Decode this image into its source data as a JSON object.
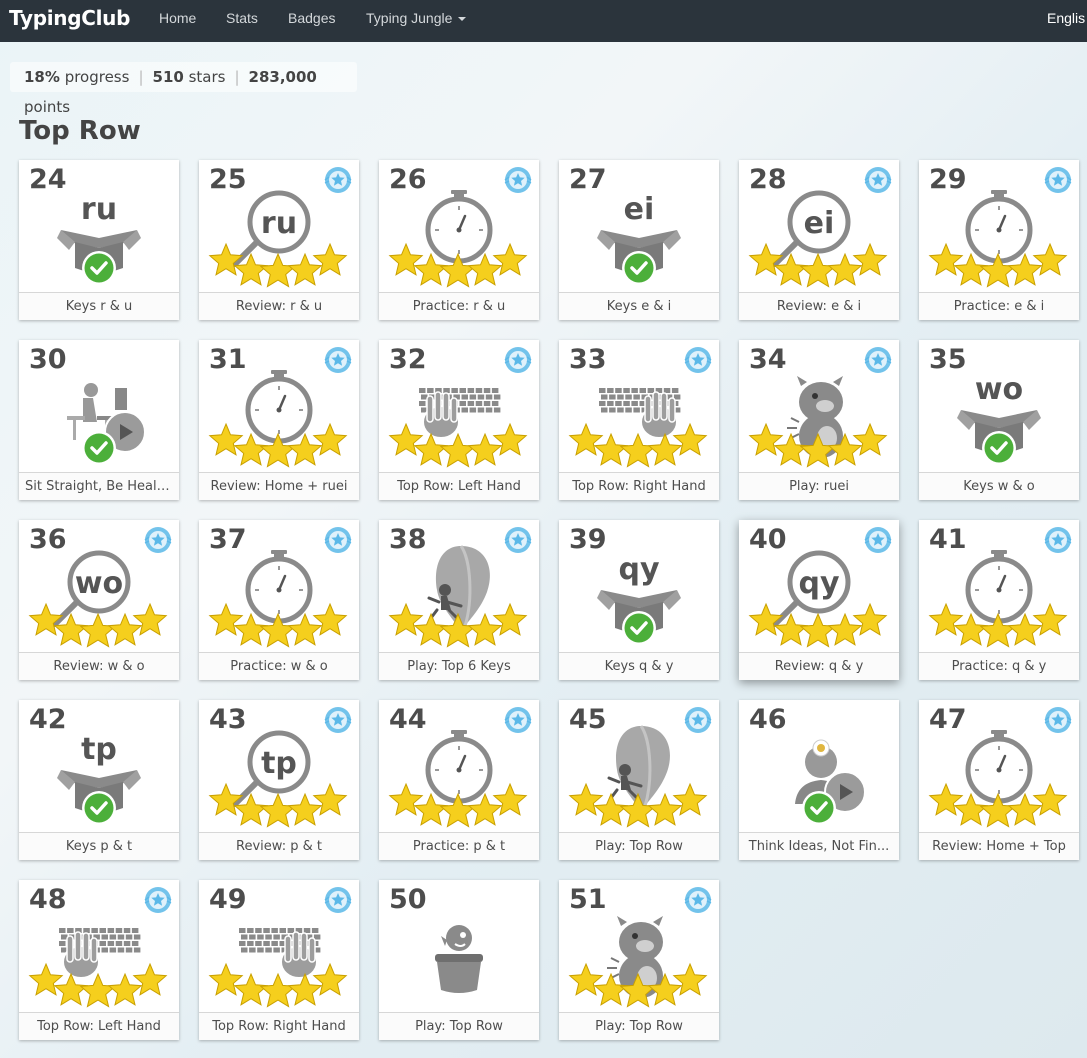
{
  "nav": {
    "brand": "TypingClub",
    "items": [
      "Home",
      "Stats",
      "Badges",
      "Typing Jungle"
    ],
    "language": "Englis"
  },
  "progress": {
    "percent": "18%",
    "percent_label": "progress",
    "stars": "510",
    "stars_label": "stars",
    "points": "283,000",
    "points_label": "points"
  },
  "section": {
    "title": "Top Row"
  },
  "lessons": [
    {
      "num": "24",
      "title": "Keys r & u",
      "kind": "box",
      "keys": "ru",
      "badge": false,
      "stars": 0
    },
    {
      "num": "25",
      "title": "Review: r & u",
      "kind": "review",
      "keys": "ru",
      "badge": true,
      "stars": 5
    },
    {
      "num": "26",
      "title": "Practice: r & u",
      "kind": "timer",
      "badge": true,
      "stars": 5
    },
    {
      "num": "27",
      "title": "Keys e & i",
      "kind": "box",
      "keys": "ei",
      "badge": false,
      "stars": 0
    },
    {
      "num": "28",
      "title": "Review: e & i",
      "kind": "review",
      "keys": "ei",
      "badge": true,
      "stars": 5
    },
    {
      "num": "29",
      "title": "Practice: e & i",
      "kind": "timer",
      "badge": true,
      "stars": 5
    },
    {
      "num": "30",
      "title": "Sit Straight, Be Healt...",
      "kind": "video-desk",
      "badge": false,
      "stars": 0
    },
    {
      "num": "31",
      "title": "Review: Home + ruei",
      "kind": "timer",
      "badge": true,
      "stars": 5
    },
    {
      "num": "32",
      "title": "Top Row: Left Hand",
      "kind": "keyboard-left",
      "badge": true,
      "stars": 5
    },
    {
      "num": "33",
      "title": "Top Row: Right Hand",
      "kind": "keyboard-right",
      "badge": true,
      "stars": 5
    },
    {
      "num": "34",
      "title": "Play: ruei",
      "kind": "monster",
      "badge": true,
      "stars": 5
    },
    {
      "num": "35",
      "title": "Keys w & o",
      "kind": "box",
      "keys": "wo",
      "badge": false,
      "stars": 0
    },
    {
      "num": "36",
      "title": "Review: w & o",
      "kind": "review",
      "keys": "wo",
      "badge": true,
      "stars": 5
    },
    {
      "num": "37",
      "title": "Practice: w & o",
      "kind": "timer",
      "badge": true,
      "stars": 5
    },
    {
      "num": "38",
      "title": "Play: Top 6 Keys",
      "kind": "balloon",
      "badge": true,
      "stars": 5
    },
    {
      "num": "39",
      "title": "Keys q & y",
      "kind": "box",
      "keys": "qy",
      "badge": false,
      "stars": 0
    },
    {
      "num": "40",
      "title": "Review: q & y",
      "kind": "review",
      "keys": "qy",
      "badge": true,
      "stars": 5,
      "highlight": true
    },
    {
      "num": "41",
      "title": "Practice: q & y",
      "kind": "timer",
      "badge": true,
      "stars": 5
    },
    {
      "num": "42",
      "title": "Keys p & t",
      "kind": "box",
      "keys": "tp",
      "badge": false,
      "stars": 0
    },
    {
      "num": "43",
      "title": "Review: p & t",
      "kind": "review",
      "keys": "tp",
      "badge": true,
      "stars": 5
    },
    {
      "num": "44",
      "title": "Practice: p & t",
      "kind": "timer",
      "badge": true,
      "stars": 5
    },
    {
      "num": "45",
      "title": "Play: Top Row",
      "kind": "balloon",
      "badge": true,
      "stars": 5
    },
    {
      "num": "46",
      "title": "Think Ideas, Not Fin...",
      "kind": "video-think",
      "badge": false,
      "stars": 0
    },
    {
      "num": "47",
      "title": "Review: Home + Top",
      "kind": "timer",
      "badge": true,
      "stars": 5
    },
    {
      "num": "48",
      "title": "Top Row: Left Hand",
      "kind": "keyboard-left",
      "badge": true,
      "stars": 5
    },
    {
      "num": "49",
      "title": "Top Row: Right Hand",
      "kind": "keyboard-right",
      "badge": true,
      "stars": 5
    },
    {
      "num": "50",
      "title": "Play: Top Row",
      "kind": "pot",
      "badge": false,
      "stars": 0
    },
    {
      "num": "51",
      "title": "Play: Top Row",
      "kind": "monster",
      "badge": true,
      "stars": 5
    }
  ],
  "colors": {
    "navbar": "#2b343c",
    "star": "#f5cf1d",
    "check": "#4caf3a",
    "badge": "#5bb8e8",
    "icon_gray": "#8a8a8a"
  }
}
